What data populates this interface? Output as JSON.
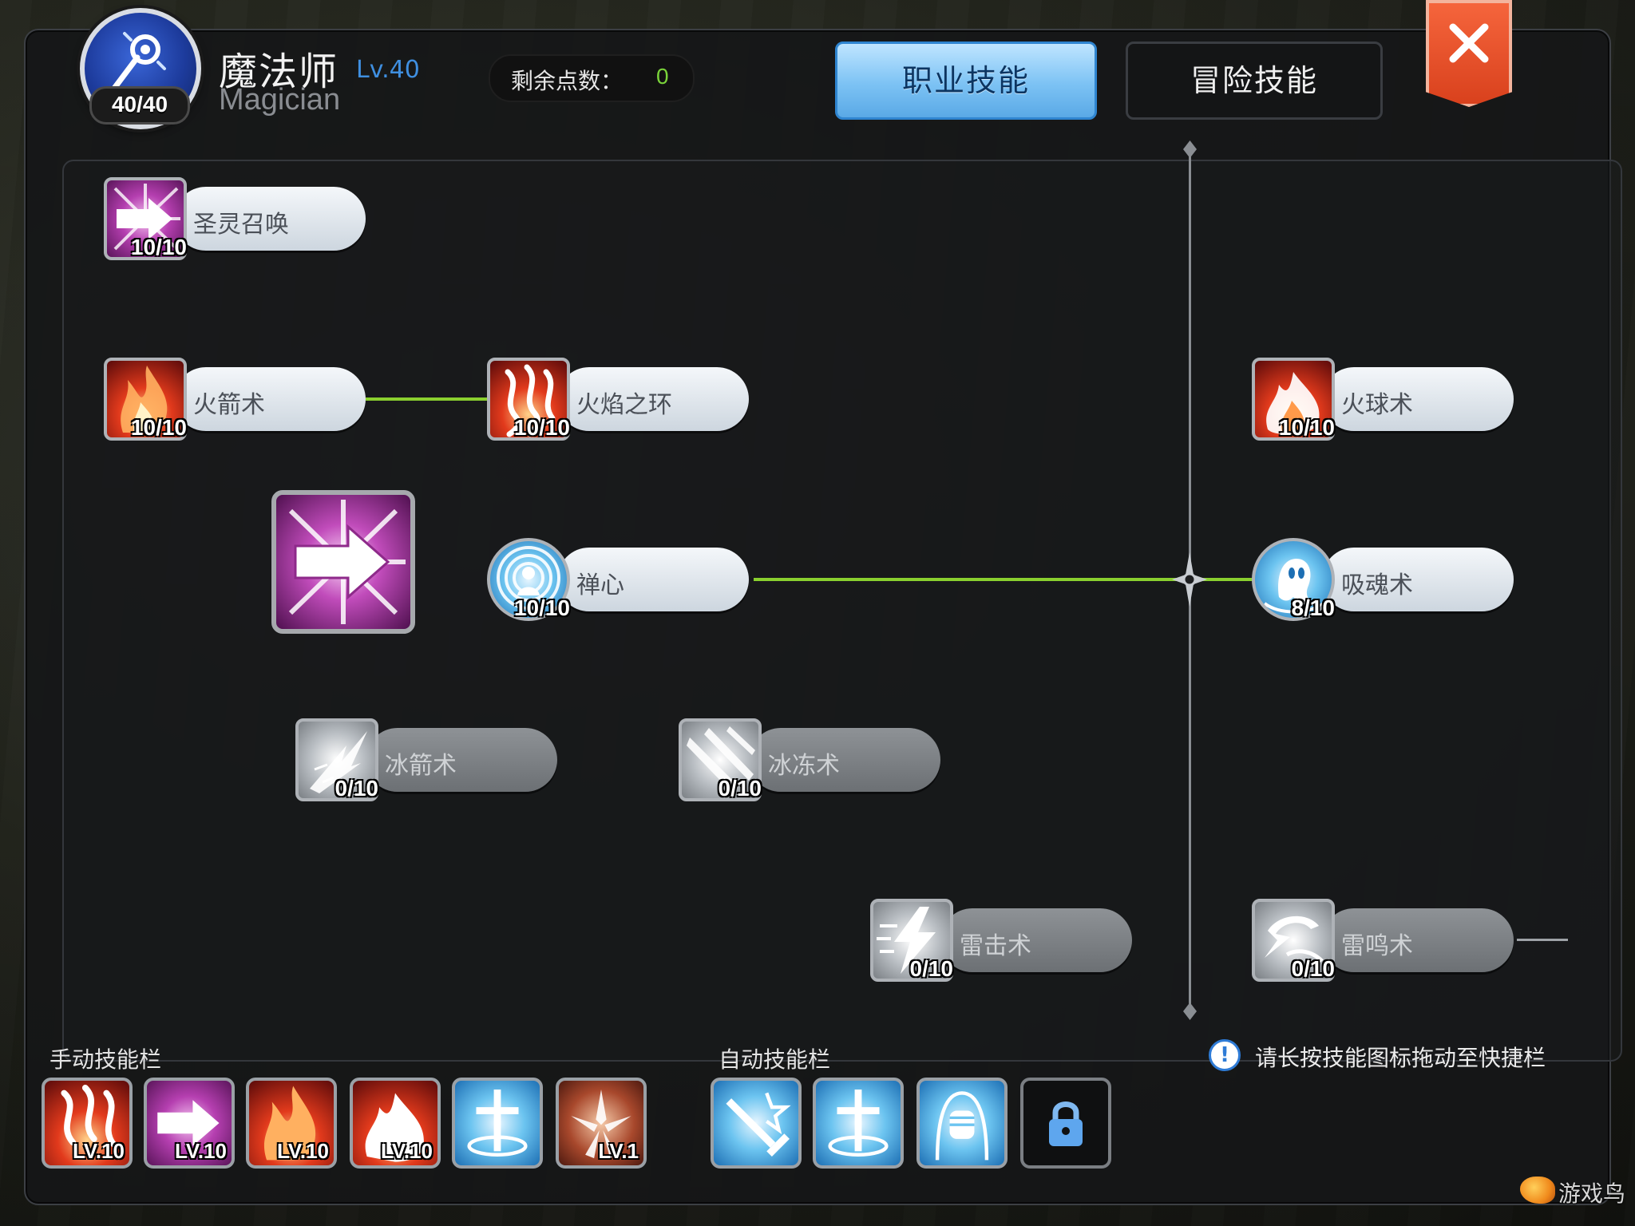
{
  "header": {
    "class_name": "魔法师",
    "class_level": "Lv.40",
    "class_name_en": "Magician",
    "emblem_count": "40/40",
    "points_label": "剩余点数：",
    "points_value": "0"
  },
  "tabs": [
    {
      "label": "职业技能",
      "active": true
    },
    {
      "label": "冒险技能",
      "active": false
    }
  ],
  "skills": [
    {
      "name": "圣灵召唤",
      "level": "10/10",
      "icon": "arrow-burst-icon",
      "state": "learned"
    },
    {
      "name": "火箭术",
      "level": "10/10",
      "icon": "fire-arrow-icon",
      "state": "learned"
    },
    {
      "name": "火焰之环",
      "level": "10/10",
      "icon": "fire-ring-icon",
      "state": "learned"
    },
    {
      "name": "火球术",
      "level": "10/10",
      "icon": "fireball-icon",
      "state": "learned"
    },
    {
      "name": "禅心",
      "level": "10/10",
      "icon": "meditation-icon",
      "state": "learned"
    },
    {
      "name": "吸魂术",
      "level": "8/10",
      "icon": "soul-drain-icon",
      "state": "learned"
    },
    {
      "name": "冰箭术",
      "level": "0/10",
      "icon": "ice-arrow-icon",
      "state": "locked"
    },
    {
      "name": "冰冻术",
      "level": "0/10",
      "icon": "frost-icon",
      "state": "locked"
    },
    {
      "name": "雷击术",
      "level": "0/10",
      "icon": "lightning-bolt-icon",
      "state": "locked"
    },
    {
      "name": "雷鸣术",
      "level": "0/10",
      "icon": "thunder-icon",
      "state": "locked"
    }
  ],
  "manual_bar": {
    "label": "手动技能栏",
    "slots": [
      {
        "icon": "fire-ring-icon",
        "level": "LV.10"
      },
      {
        "icon": "arrow-burst-icon",
        "level": "LV.10"
      },
      {
        "icon": "fire-arrow-icon",
        "level": "LV.10"
      },
      {
        "icon": "fireball-icon",
        "level": "LV.10"
      },
      {
        "icon": "holy-cross-icon",
        "level": ""
      },
      {
        "icon": "crystal-shatter-icon",
        "level": "LV.1"
      }
    ]
  },
  "auto_bar": {
    "label": "自动技能栏",
    "slots": [
      {
        "icon": "sword-burst-icon"
      },
      {
        "icon": "holy-cross-icon"
      },
      {
        "icon": "fist-icon"
      },
      {
        "icon": "lock-icon"
      }
    ]
  },
  "hint": "请长按技能图标拖动至快捷栏",
  "watermark": "游戏鸟",
  "colors": {
    "accent_tab": "#7cc2f4",
    "points_value": "#7ad33a",
    "connector": "#8ad02f",
    "close_button": "#e24f28"
  }
}
